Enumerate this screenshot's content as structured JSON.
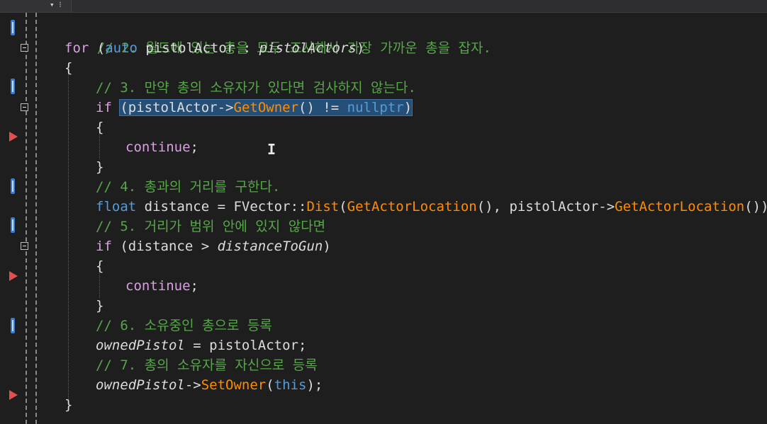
{
  "code": {
    "lines": [
      {
        "comment": "// 2. 월드에 있는 총을 모두 조사해서 가장 가까운 총을 잡자."
      },
      {
        "kw_for": "for",
        "paren_open": " (",
        "kw_auto": "auto",
        "var": " pistolActor : ",
        "var_it": "pistolActors",
        "paren_close": ")"
      },
      {
        "text": "{"
      },
      {
        "comment": "// 3. 만약 총의 소유자가 있다면 검사하지 않는다."
      },
      {
        "kw_if": "if",
        "space": " ",
        "sel_a": "(pistolActor->",
        "sel_fn": "GetOwner",
        "sel_b": "() != ",
        "sel_null": "nullptr",
        "sel_c": ")"
      },
      {
        "text": "{"
      },
      {
        "kw_continue": "continue",
        "semi": ";"
      },
      {
        "text": "}"
      },
      {
        "comment": "// 4. 총과의 거리를 구한다."
      },
      {
        "kw_float": "float",
        "a": " distance = ",
        "type": "FVector",
        "b": "::",
        "fn1": "Dist",
        "c": "(",
        "fn2": "GetActorLocation",
        "d": "(), pistolActor->",
        "fn3": "GetActorLocation",
        "e": "());"
      },
      {
        "comment": "// 5. 거리가 범위 안에 있지 않다면"
      },
      {
        "kw_if": "if",
        "a": " (distance > ",
        "var_it": "distanceToGun",
        "b": ")"
      },
      {
        "text": "{"
      },
      {
        "kw_continue": "continue",
        "semi": ";"
      },
      {
        "text": "}"
      },
      {
        "comment": "// 6. 소유중인 총으로 등록"
      },
      {
        "var_it": "ownedPistol",
        "a": " = pistolActor;"
      },
      {
        "comment": "// 7. 총의 소유자를 자신으로 등록"
      },
      {
        "var_it": "ownedPistol",
        "a": "->",
        "fn": "SetOwner",
        "b": "(",
        "kw_this": "this",
        "c": ");"
      },
      {
        "text": "}"
      }
    ]
  }
}
